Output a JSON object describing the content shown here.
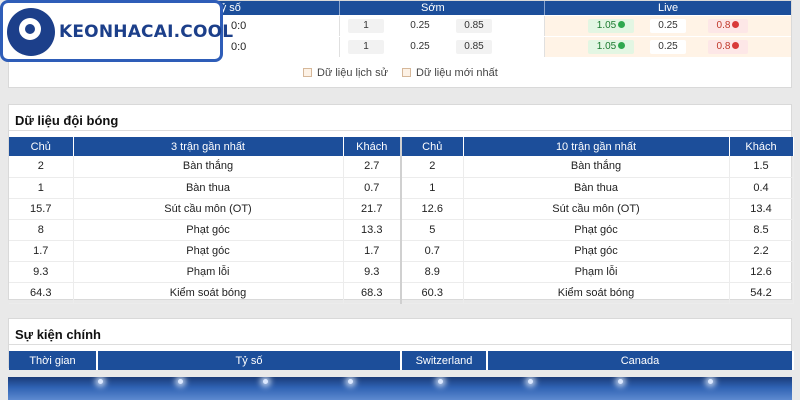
{
  "logo": {
    "text": "KEONHACAI.COOL"
  },
  "odds": {
    "headers": {
      "score": "Tỷ số",
      "early": "Sớm",
      "live": "Live"
    },
    "rows": [
      {
        "score": "0:0",
        "early": [
          "1",
          "0.25",
          "0.85"
        ],
        "live": [
          "1.05",
          "0.25",
          "0.8"
        ]
      },
      {
        "score": "0:0",
        "early": [
          "1",
          "0.25",
          "0.85"
        ],
        "live": [
          "1.05",
          "0.25",
          "0.8"
        ]
      }
    ],
    "legend": {
      "history": "Dữ liệu lịch sử",
      "latest": "Dữ liệu mới nhất"
    }
  },
  "team_data": {
    "title": "Dữ liệu đội bóng",
    "headers": {
      "home": "Chủ",
      "last3": "3 trận gần nhất",
      "away": "Khách",
      "last10": "10 trận gần nhất"
    },
    "rows": [
      {
        "h3": "2",
        "label": "Bàn thắng",
        "a3": "2.7",
        "h10": "2",
        "label10": "Bàn thắng",
        "a10": "1.5"
      },
      {
        "h3": "1",
        "label": "Bàn thua",
        "a3": "0.7",
        "h10": "1",
        "label10": "Bàn thua",
        "a10": "0.4"
      },
      {
        "h3": "15.7",
        "label": "Sút cầu môn (OT)",
        "a3": "21.7",
        "h10": "12.6",
        "label10": "Sút cầu môn (OT)",
        "a10": "13.4"
      },
      {
        "h3": "8",
        "label": "Phạt góc",
        "a3": "13.3",
        "h10": "5",
        "label10": "Phạt góc",
        "a10": "8.5"
      },
      {
        "h3": "1.7",
        "label": "Phạt góc",
        "a3": "1.7",
        "h10": "0.7",
        "label10": "Phạt góc",
        "a10": "2.2"
      },
      {
        "h3": "9.3",
        "label": "Phạm lỗi",
        "a3": "9.3",
        "h10": "8.9",
        "label10": "Phạm lỗi",
        "a10": "12.6"
      },
      {
        "h3": "64.3",
        "label": "Kiểm soát bóng",
        "a3": "68.3",
        "h10": "60.3",
        "label10": "Kiểm soát bóng",
        "a10": "54.2"
      }
    ]
  },
  "events": {
    "title": "Sự kiện chính",
    "headers": {
      "time": "Thời gian",
      "score": "Tỷ số",
      "home": "Switzerland",
      "away": "Canada"
    }
  }
}
